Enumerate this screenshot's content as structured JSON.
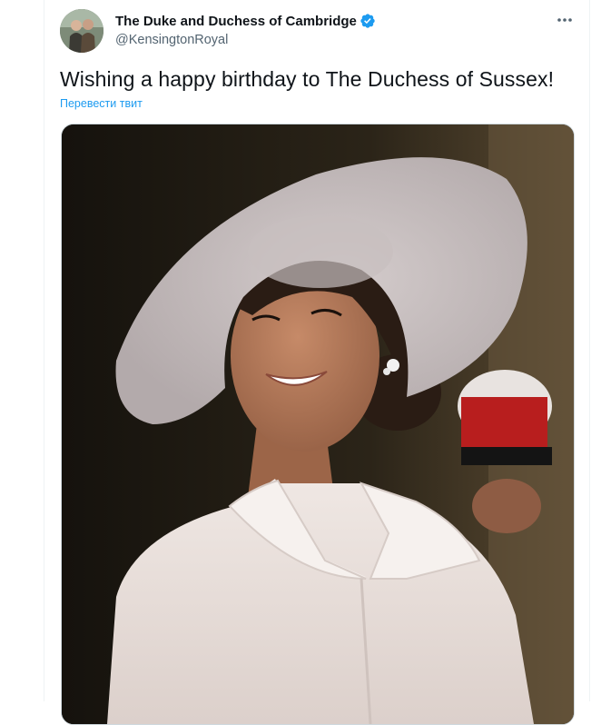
{
  "account": {
    "display_name": "The Duke and Duchess of Cambridge",
    "handle": "@KensingtonRoyal",
    "verified": true
  },
  "tweet": {
    "text": "Wishing a happy birthday to The Duchess of Sussex!",
    "translate_label": "Перевести твит"
  },
  "icons": {
    "verified": "verified-badge-icon",
    "more": "more-options-icon"
  },
  "colors": {
    "accent": "#1d9bf0",
    "text_primary": "#0f1419",
    "text_secondary": "#536471"
  }
}
